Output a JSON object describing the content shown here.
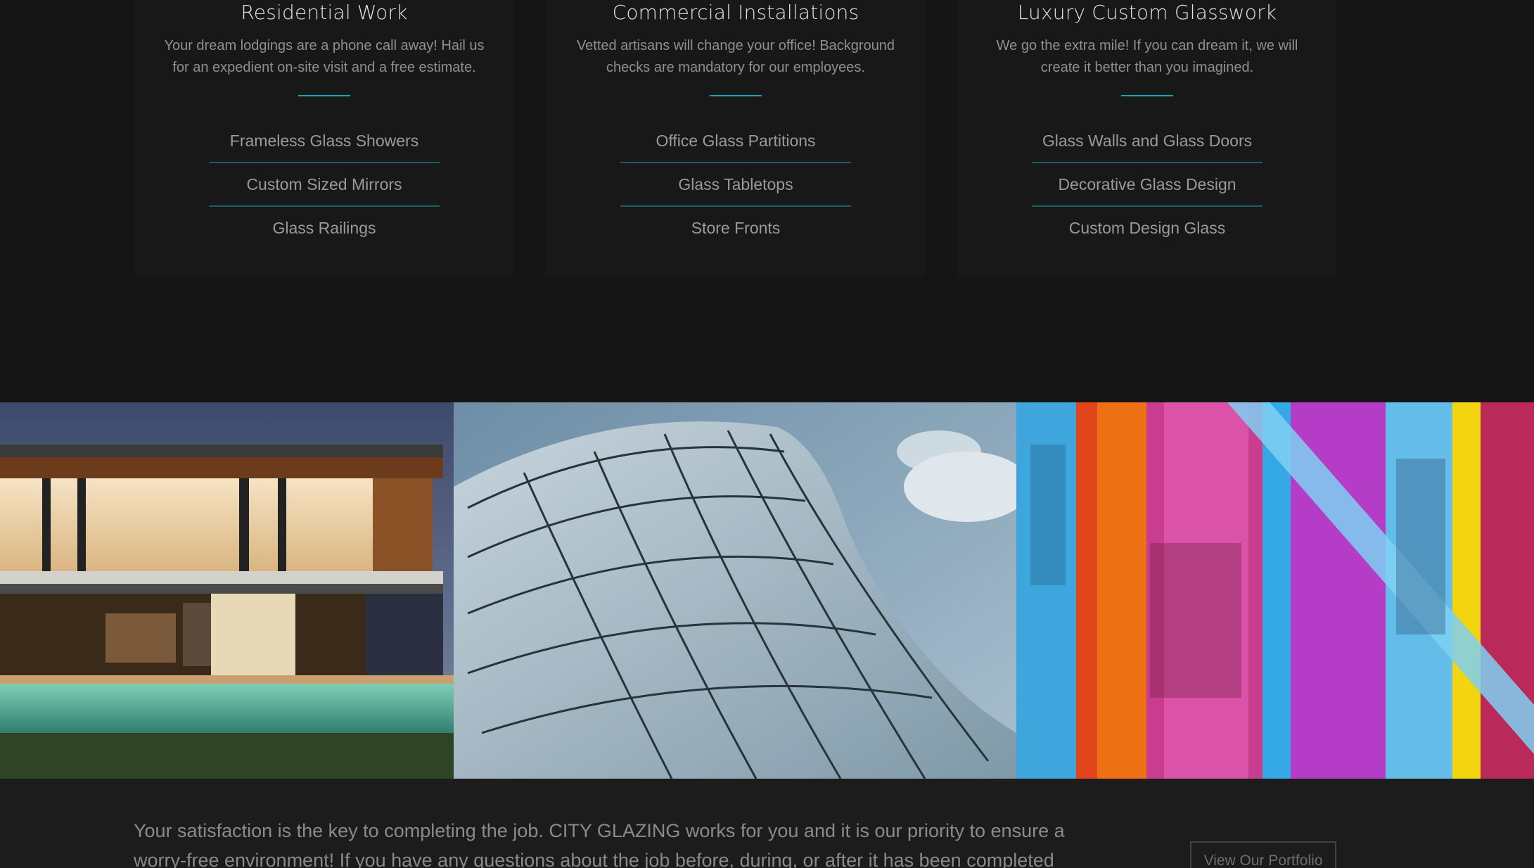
{
  "services": [
    {
      "title": "Residential Work",
      "description": "Your dream lodgings are a phone call away! Hail us for an expedient on-site visit and a free estimate.",
      "items": [
        "Frameless Glass Showers",
        "Custom Sized Mirrors",
        "Glass Railings"
      ]
    },
    {
      "title": "Commercial Installations",
      "description": "Vetted artisans will change your office! Background checks are mandatory for our employees.",
      "items": [
        "Office Glass Partitions",
        "Glass Tabletops",
        "Store Fronts"
      ]
    },
    {
      "title": "Luxury Custom Glasswork",
      "description": "We go the extra mile! If you can dream it, we will create it better than you imagined.",
      "items": [
        "Glass Walls and Glass Doors",
        "Decorative Glass Design",
        "Custom Design Glass"
      ]
    }
  ],
  "gallery": {
    "images": [
      "modern-glass-house-photo",
      "curved-glass-facade-photo",
      "colored-glass-panels-photo"
    ]
  },
  "footer": {
    "satisfaction_text": "Your satisfaction is the key to completing the job. CITY GLAZING works for you and it is our priority to ensure a worry-free environment! If you have any questions about the job before, during, or after it has been completed",
    "portfolio_button": "View Our Portfolio"
  },
  "colors": {
    "accent": "#14a8b6",
    "divider": "#1f5d63",
    "background": "#151515",
    "card": "#181818"
  }
}
